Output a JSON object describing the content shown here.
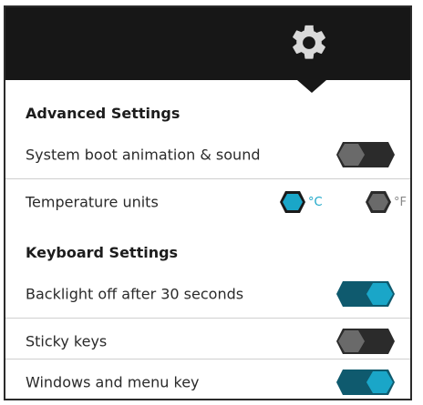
{
  "header": {
    "icon": "gear-icon"
  },
  "colors": {
    "header_bg": "#171717",
    "accent": "#1aa6c8",
    "toggle_on_track": "#0f5a6e",
    "toggle_off_track": "#2b2b2b",
    "toggle_off_knob": "#6a6a6a"
  },
  "advanced": {
    "title": "Advanced Settings",
    "boot_animation": {
      "label": "System boot animation & sound",
      "state": "off"
    },
    "temperature": {
      "label": "Temperature units",
      "options": [
        {
          "label": "°C",
          "selected": true
        },
        {
          "label": "°F",
          "selected": false
        }
      ]
    }
  },
  "keyboard": {
    "title": "Keyboard Settings",
    "backlight": {
      "label": "Backlight off after 30 seconds",
      "state": "on"
    },
    "sticky_keys": {
      "label": "Sticky keys",
      "state": "off"
    },
    "windows_menu_key": {
      "label": "Windows and menu key",
      "state": "on"
    }
  }
}
